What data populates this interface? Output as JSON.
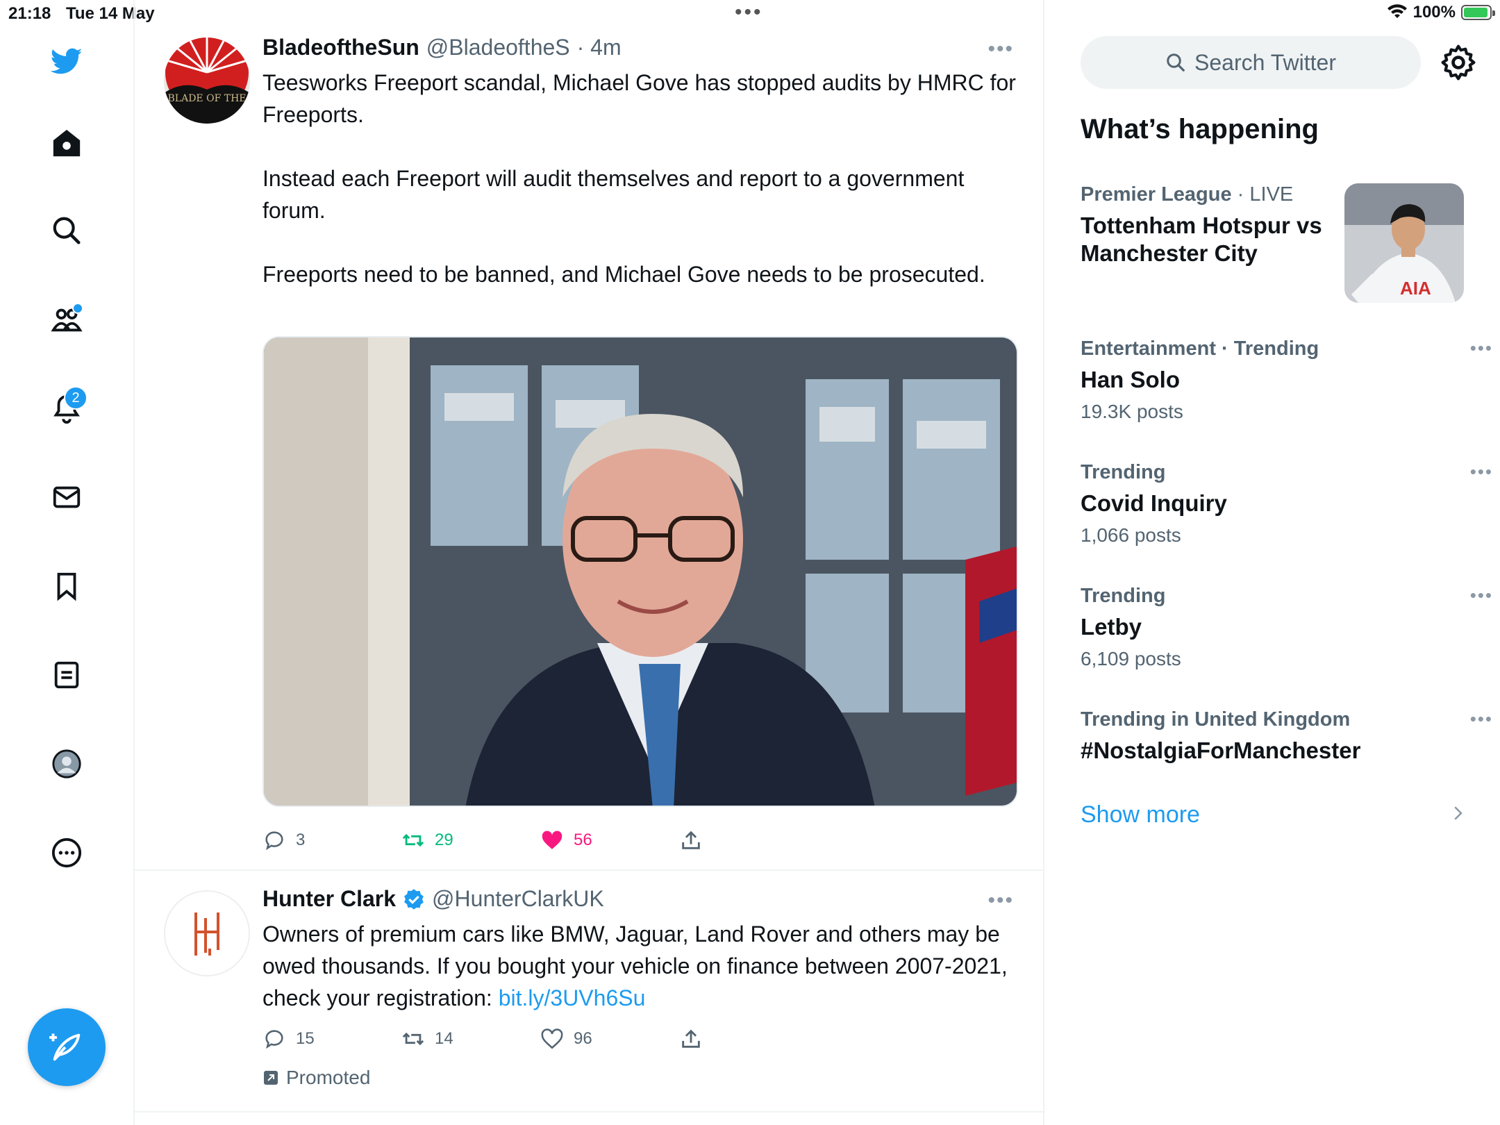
{
  "status_bar": {
    "time": "21:18",
    "date": "Tue 14 May",
    "battery": "100%",
    "battery_color": "#34c759"
  },
  "nav": {
    "notifications_badge": "2",
    "icons": [
      "twitter-logo-icon",
      "home-icon",
      "search-icon",
      "communities-icon",
      "bell-icon",
      "mail-icon",
      "bookmark-icon",
      "lists-icon",
      "profile-icon",
      "more-circle-icon",
      "compose-icon"
    ],
    "accent": "#1d9bf0"
  },
  "tweets": [
    {
      "name": "BladeoftheSun",
      "handle": "@BladeoftheS",
      "time": "· 4m",
      "text": "Teesworks Freeport scandal, Michael Gove has stopped audits by HMRC for Freeports.\n\nInstead each Freeport will audit themselves and report to a government forum.\n\nFreeports need to be banned, and Michael Gove needs to be prosecuted.",
      "avatar_text": "BLADE OF THE",
      "replies": "3",
      "retweets": "29",
      "likes": "56",
      "retweet_color": "#00ba7c",
      "like_color": "#f91880"
    },
    {
      "name": "Hunter Clark",
      "handle": "@HunterClarkUK",
      "text": "Owners of premium cars like BMW, Jaguar, Land Rover and others may be owed thousands. If you bought your vehicle on finance between 2007-2021, check your registration: ",
      "link": "bit.ly/3UVh6Su",
      "replies": "15",
      "retweets": "14",
      "likes": "96",
      "promoted": "Promoted"
    }
  ],
  "sidebar": {
    "search_placeholder": "Search Twitter",
    "whats_happening": "What’s happening",
    "trends": [
      {
        "meta_category": "Premier League",
        "meta_extra": " · LIVE",
        "title": "Tottenham Hotspur vs Manchester City",
        "count": "",
        "image_label": "AIA"
      },
      {
        "meta_category": "Entertainment · Trending",
        "meta_extra": "",
        "title": "Han Solo",
        "count": "19.3K posts"
      },
      {
        "meta_category": "Trending",
        "meta_extra": "",
        "title": "Covid Inquiry",
        "count": "1,066 posts"
      },
      {
        "meta_category": "Trending",
        "meta_extra": "",
        "title": "Letby",
        "count": "6,109 posts"
      },
      {
        "meta_category": "Trending in United Kingdom",
        "meta_extra": "",
        "title": "#NostalgiaForManchester",
        "count": ""
      }
    ],
    "show_more": "Show more"
  }
}
